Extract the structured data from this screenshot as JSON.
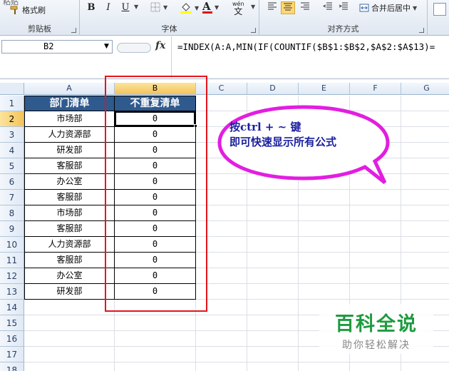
{
  "ribbon": {
    "clipboard": {
      "partial_top": "粘贴",
      "format_painter": "格式刷",
      "group_label": "剪贴板"
    },
    "font": {
      "bold": "B",
      "italic": "I",
      "underline": "U",
      "font_color_glyph": "A",
      "wen_glyph": "wén",
      "wen_char": "文",
      "group_label": "字体"
    },
    "alignment": {
      "merge_center": "合并后居中",
      "group_label": "对齐方式"
    }
  },
  "formula_bar": {
    "name_box": "B2",
    "fx_label": "fx",
    "formula": "=INDEX(A:A,MIN(IF(COUNTIF($B$1:$B$2,$A$2:$A$13)="
  },
  "columns": [
    "A",
    "B",
    "C",
    "D",
    "E",
    "F",
    "G"
  ],
  "rows": [
    "1",
    "2",
    "3",
    "4",
    "5",
    "6",
    "7",
    "8",
    "9",
    "10",
    "11",
    "12",
    "13",
    "14",
    "15",
    "16",
    "17",
    "18"
  ],
  "table": {
    "header_a": "部门清单",
    "header_b": "不重复清单",
    "departments": [
      "市场部",
      "人力资源部",
      "研发部",
      "客服部",
      "办公室",
      "客服部",
      "市场部",
      "客服部",
      "人力资源部",
      "客服部",
      "办公室",
      "研发部"
    ],
    "results": [
      "0",
      "0",
      "0",
      "0",
      "0",
      "0",
      "0",
      "0",
      "0",
      "0",
      "0",
      "0"
    ]
  },
  "callout": {
    "line1": "按ctrl + ~ 键",
    "line2": "即可快速显示所有公式",
    "border_color": "#e21ee0"
  },
  "watermark": {
    "title": "百科全说",
    "subtitle": "助你轻松解决"
  },
  "colors": {
    "header_fill": "#2f5a8e",
    "highlight_box": "#e5141c",
    "watermark_green": "#1e9b3f"
  }
}
